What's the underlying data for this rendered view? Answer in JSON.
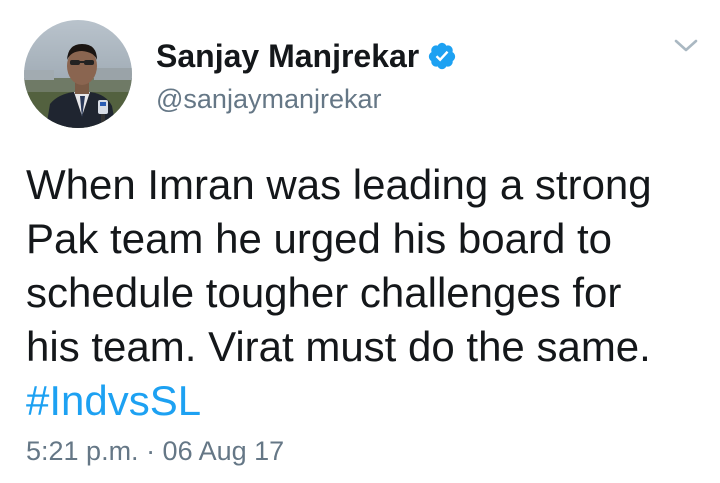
{
  "tweet": {
    "author": {
      "display_name": "Sanjay Manjrekar",
      "handle": "@sanjaymanjrekar",
      "verified": true,
      "avatar_icon": "profile-photo"
    },
    "text_lines": [
      "When Imran was leading a strong",
      "Pak team he urged his board to",
      "schedule tougher challenges for",
      "his team. Virat must do the same."
    ],
    "hashtag": "#IndvsSL",
    "timestamp": "5:21 p.m. · 06 Aug 17",
    "menu_icon": "chevron-down-icon"
  },
  "colors": {
    "text": "#14171a",
    "secondary": "#657786",
    "link": "#1da1f2",
    "verified_badge": "#1da1f2"
  }
}
